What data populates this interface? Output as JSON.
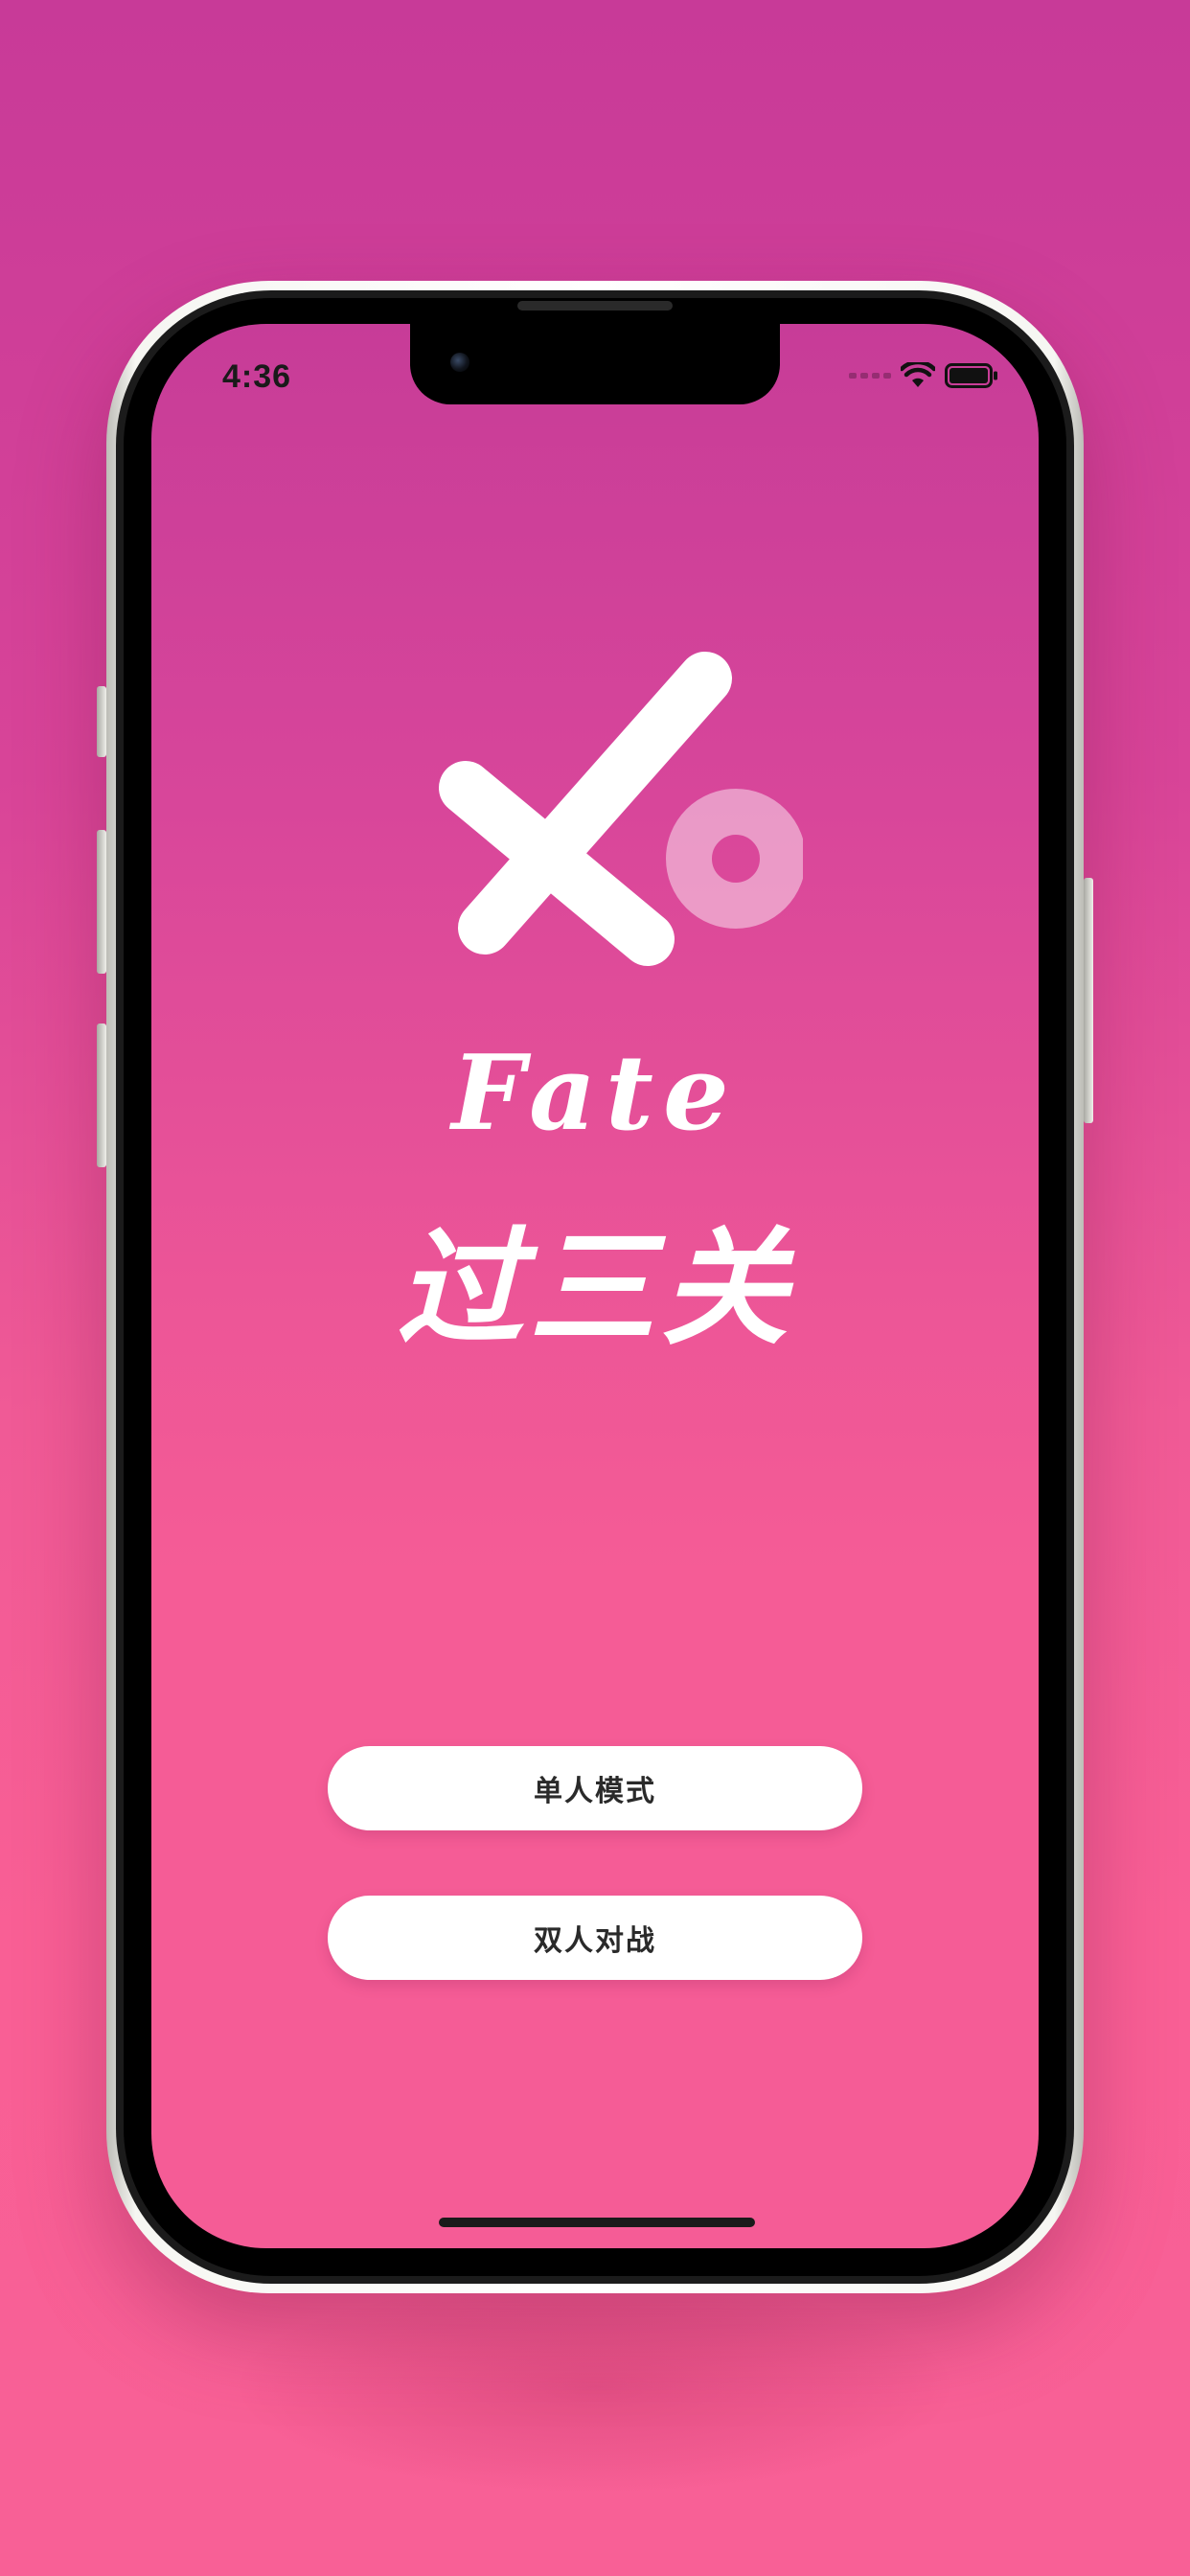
{
  "status_bar": {
    "time": "4:36",
    "icons": [
      "signal-dots-icon",
      "wifi-icon",
      "battery-icon"
    ]
  },
  "app": {
    "logo_icon": "x-and-o-logo-icon",
    "title_en": "Fate",
    "title_cn": "过三关"
  },
  "menu": {
    "single_player_label": "单人模式",
    "two_player_label": "双人对战"
  },
  "colors": {
    "background_top": "#c83a98",
    "background_bottom": "#f95f95",
    "button_bg": "#ffffff",
    "button_text": "#2a2a2a"
  }
}
